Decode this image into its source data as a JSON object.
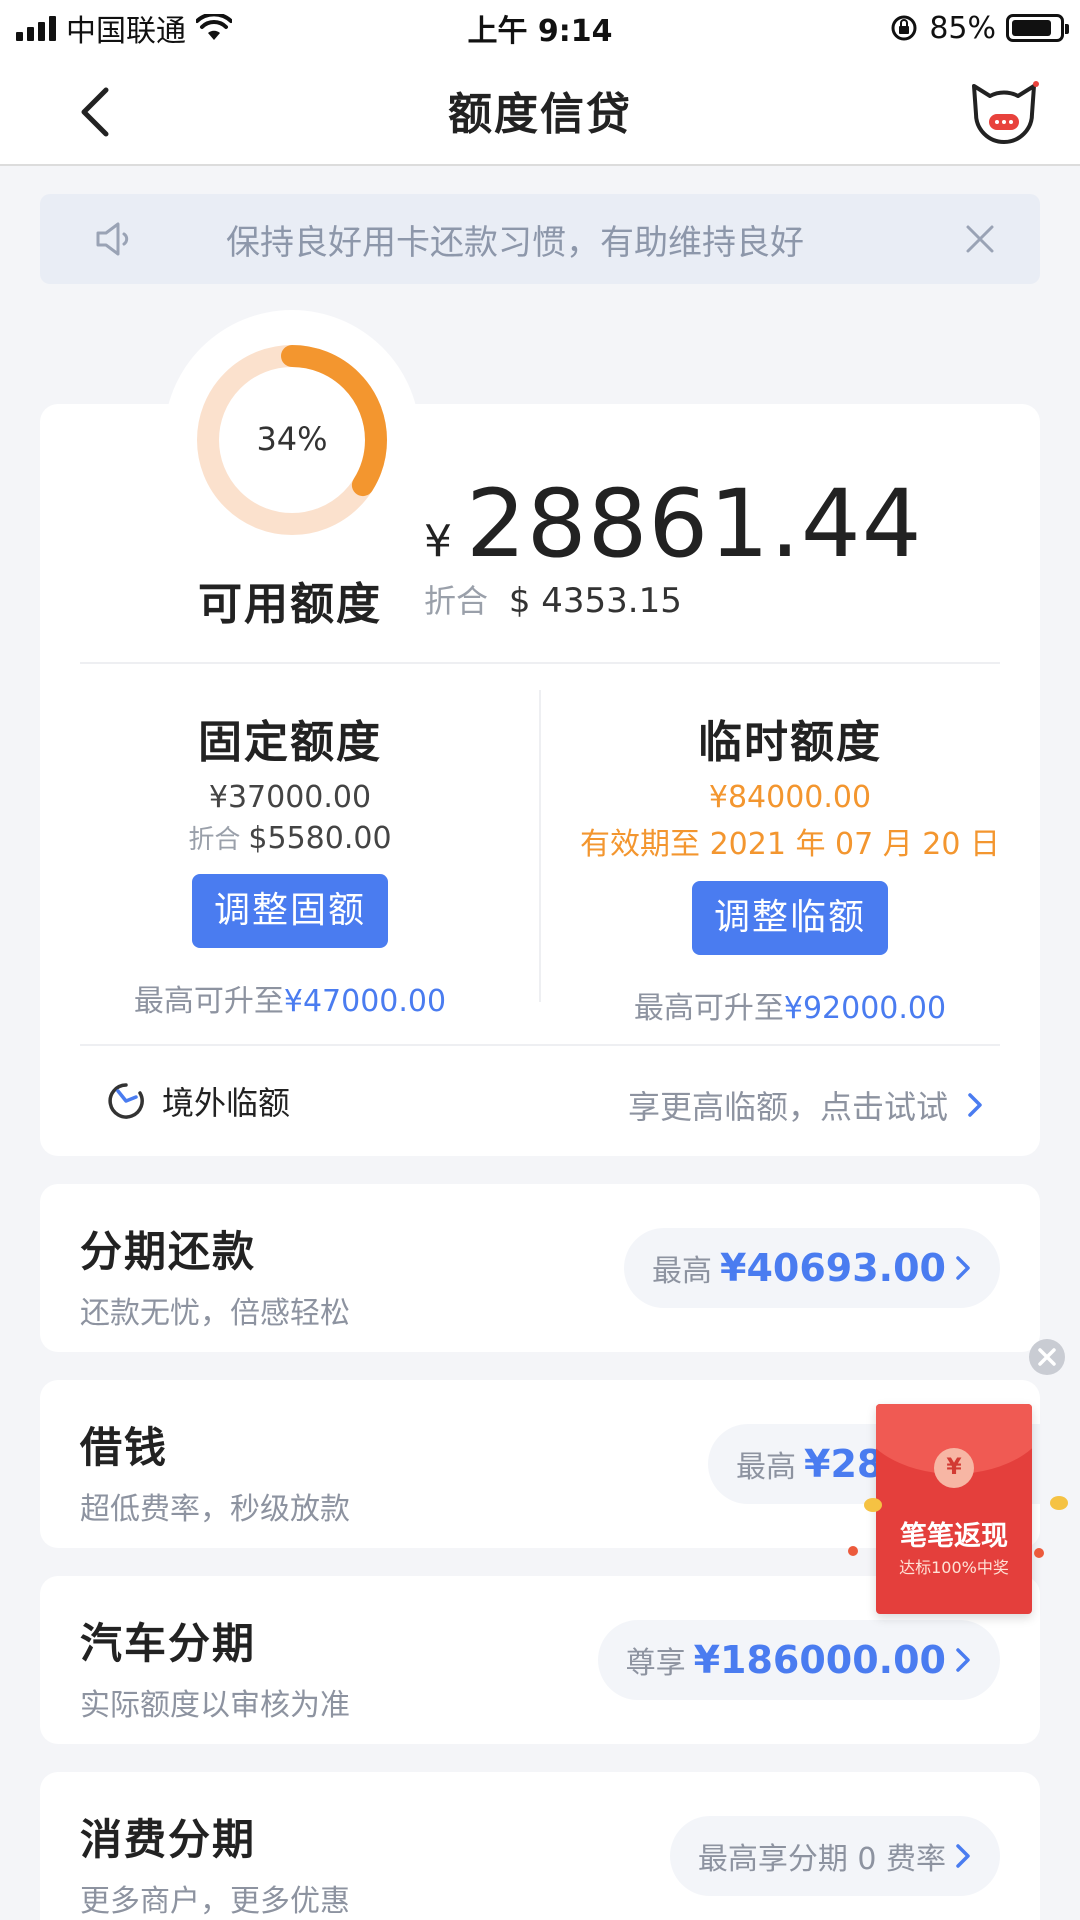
{
  "status_bar": {
    "carrier": "中国联通",
    "time": "上午 9:14",
    "battery": "85%"
  },
  "nav": {
    "title": "额度信贷"
  },
  "notice": {
    "text": "保持良好用卡还款习惯，有助维持良好"
  },
  "credit": {
    "usage_percent": 34,
    "usage_label": "34%",
    "available_label": "可用额度",
    "currency_symbol": "¥",
    "available_amount": "28861.44",
    "usd_label": "折合",
    "usd_amount": "$ 4353.15"
  },
  "fixed": {
    "title": "固定额度",
    "amount": "¥37000.00",
    "usd_label": "折合",
    "usd_amount": "$5580.00",
    "button": "调整固额",
    "max_label": "最高可升至",
    "max_amount": "¥47000.00"
  },
  "temp": {
    "title": "临时额度",
    "amount": "¥84000.00",
    "validity": "有效期至 2021 年 07 月 20 日",
    "button": "调整临额",
    "max_label": "最高可升至",
    "max_amount": "¥92000.00"
  },
  "overseas": {
    "label": "境外临额",
    "hint": "享更高临额，点击试试"
  },
  "list": [
    {
      "title": "分期还款",
      "subtitle": "还款无忧，倍感轻松",
      "pill_label": "最高",
      "pill_value": "¥40693.00"
    },
    {
      "title": "借钱",
      "subtitle": "超低费率，秒级放款",
      "pill_label": "最高",
      "pill_value": "¥28"
    },
    {
      "title": "汽车分期",
      "subtitle": "实际额度以审核为准",
      "pill_label": "尊享",
      "pill_value": "¥186000.00"
    },
    {
      "title": "消费分期",
      "subtitle": "更多商户，更多优惠",
      "pill_label": "最高享分期 0 费率",
      "pill_value": ""
    }
  ],
  "promo": {
    "title": "笔笔返现",
    "subtitle": "达标100%中奖",
    "coin_symbol": "¥"
  },
  "colors": {
    "accent_blue": "#4a7cf0",
    "accent_orange": "#f3962f",
    "ring_track": "#fbe1cd",
    "promo_red": "#e43f3c"
  }
}
